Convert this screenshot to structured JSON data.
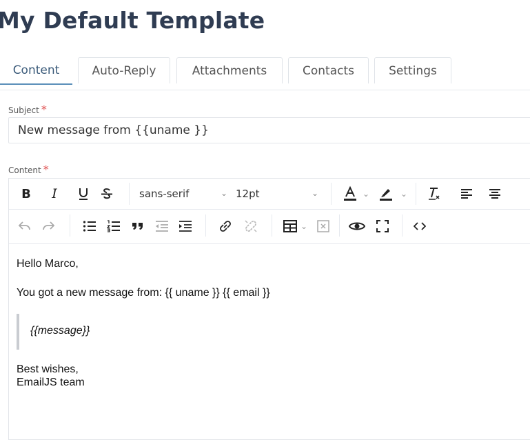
{
  "page_title": "My Default Template",
  "tabs": [
    "Content",
    "Auto-Reply",
    "Attachments",
    "Contacts",
    "Settings"
  ],
  "subject": {
    "label": "Subject",
    "value": "New message from {{uname }}"
  },
  "content": {
    "label": "Content"
  },
  "required_mark": "*",
  "toolbar": {
    "font_family": "sans-serif",
    "font_size": "12pt"
  },
  "body": {
    "greeting": "Hello Marco,",
    "line1": "You got a new message from: {{ uname }} {{ email }}",
    "quote": "{{message}}",
    "signoff1": "Best wishes,",
    "signoff2": "EmailJS team"
  },
  "colors": {
    "title": "#2f3c52",
    "required": "#e05555",
    "active_tab": "#5b8fb9"
  }
}
